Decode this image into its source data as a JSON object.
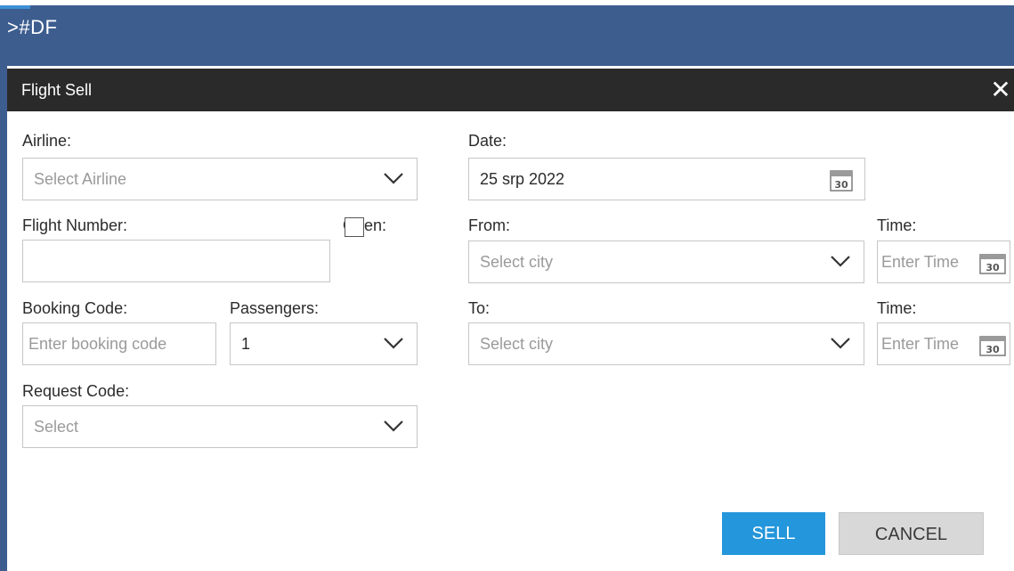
{
  "command_bar": {
    "text": ">#DF"
  },
  "dialog": {
    "title": "Flight Sell",
    "close_glyph": "✕",
    "airline": {
      "label": "Airline:",
      "placeholder": "Select Airline"
    },
    "date": {
      "label": "Date:",
      "value": "25 srp 2022",
      "icon": "calendar-icon",
      "icon_day": "30"
    },
    "flight_number": {
      "label": "Flight Number:",
      "value": ""
    },
    "open": {
      "label": "Open:",
      "checked": false
    },
    "from": {
      "label": "From:",
      "placeholder": "Select city"
    },
    "from_time": {
      "label": "Time:",
      "placeholder": "Enter Time"
    },
    "booking_code": {
      "label": "Booking Code:",
      "placeholder": "Enter booking code"
    },
    "passengers": {
      "label": "Passengers:",
      "value": "1"
    },
    "to": {
      "label": "To:",
      "placeholder": "Select city"
    },
    "to_time": {
      "label": "Time:",
      "placeholder": "Enter Time"
    },
    "request_code": {
      "label": "Request Code:",
      "placeholder": "Select"
    },
    "buttons": {
      "sell": "SELL",
      "cancel": "CANCEL"
    }
  },
  "colors": {
    "command_bar": "#3d5d8f",
    "dialog_header": "#2a2a2a",
    "sell_button": "#2496db",
    "cancel_button": "#d8d8d8"
  }
}
